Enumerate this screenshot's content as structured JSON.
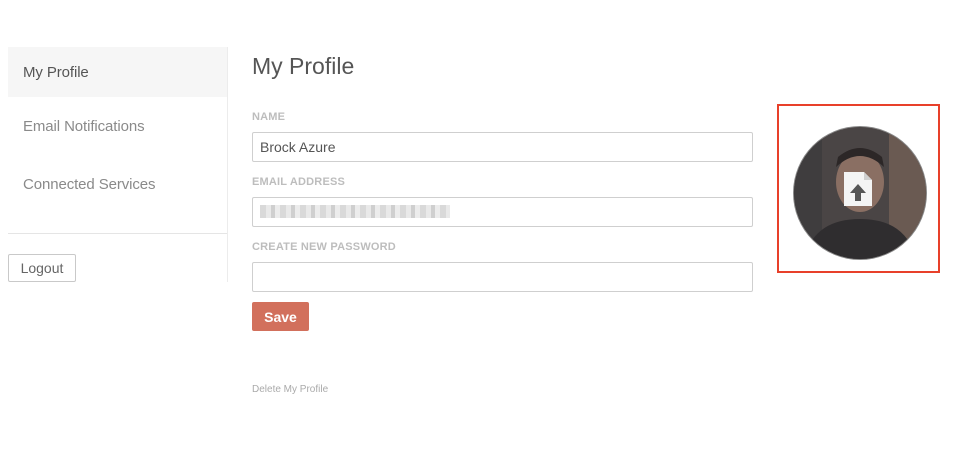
{
  "sidebar": {
    "items": [
      {
        "label": "My Profile"
      },
      {
        "label": "Email Notifications"
      },
      {
        "label": "Connected Services"
      }
    ],
    "logout_label": "Logout"
  },
  "main": {
    "title": "My Profile",
    "name_label": "NAME",
    "name_value": "Brock Azure",
    "email_label": "EMAIL ADDRESS",
    "password_label": "CREATE NEW PASSWORD",
    "save_label": "Save",
    "delete_label": "Delete My Profile"
  },
  "avatar": {
    "icon": "upload-icon"
  },
  "colors": {
    "accent": "#d2705c",
    "highlight": "#e8402a"
  }
}
